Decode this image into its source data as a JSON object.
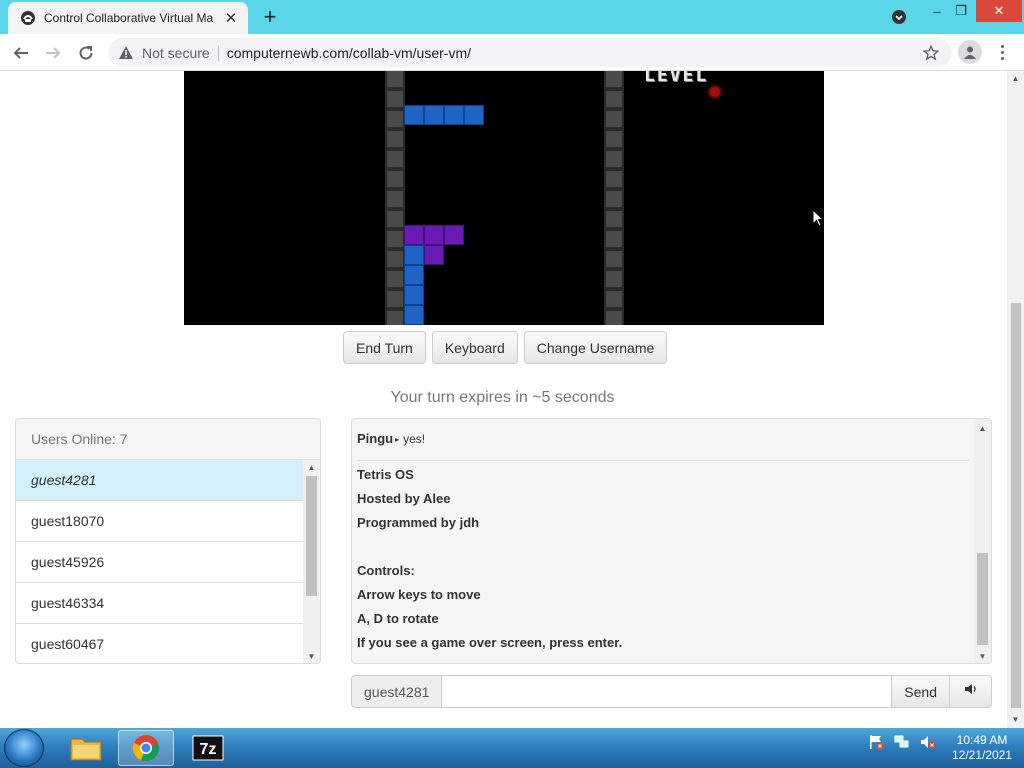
{
  "browser": {
    "tab_title": "Control Collaborative Virtual Ma",
    "omnibox": {
      "security_label": "Not secure",
      "url": "computernewb.com/collab-vm/user-vm/"
    }
  },
  "vm": {
    "level_text": "LEVEL",
    "buttons": {
      "end_turn": "End Turn",
      "keyboard": "Keyboard",
      "change_username": "Change Username"
    },
    "turn_message": "Your turn expires in ~5 seconds"
  },
  "users": {
    "header": "Users Online: 7",
    "list": [
      "guest4281",
      "guest18070",
      "guest45926",
      "guest46334",
      "guest60467"
    ]
  },
  "chat": {
    "last_message": {
      "user": "Pingu",
      "text": "yes!"
    },
    "motd": [
      "Tetris OS",
      "Hosted by Alee",
      "Programmed by jdh",
      "",
      "Controls:",
      "Arrow keys to move",
      "A, D to rotate",
      "If you see a game over screen, press enter."
    ],
    "input": {
      "username": "guest4281",
      "value": "",
      "send_label": "Send"
    }
  },
  "taskbar": {
    "clock_time": "10:49 AM",
    "clock_date": "12/21/2021"
  },
  "colors": {
    "tab_bar": "#5bd6e8",
    "selected_user": "#d2effa",
    "tetris_blue": "#1f63c4",
    "tetris_purple": "#6a1bb6"
  }
}
